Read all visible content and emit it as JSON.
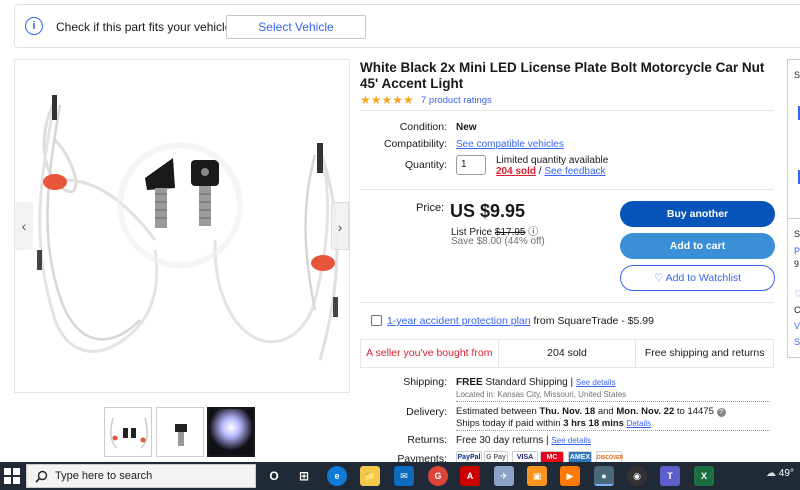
{
  "fits": {
    "text": "Check if this part fits your vehicle",
    "button": "Select Vehicle"
  },
  "listing": {
    "title": "White Black 2x Mini LED License Plate Bolt Motorcycle Car Nut 45' Accent Light",
    "stars": "★★★★★",
    "ratings_link": "7 product ratings"
  },
  "details": {
    "condition_label": "Condition:",
    "condition_value": "New",
    "compat_label": "Compatibility:",
    "compat_link": "See compatible vehicles",
    "qty_label": "Quantity:",
    "qty_value": "1",
    "qty_note": "Limited quantity available",
    "sold": "204 sold",
    "sep": " / ",
    "feedback": "See feedback"
  },
  "price": {
    "label": "Price:",
    "value": "US $9.95",
    "list_prefix": "List Price ",
    "list_value": "$17.95",
    "info_icon": "ⓘ",
    "save": "Save $8.00 (44% off)"
  },
  "buttons": {
    "buy": "Buy another",
    "cart": "Add to cart",
    "watch": "♡ Add to Watchlist"
  },
  "protection": {
    "link": "1-year accident protection plan",
    "rest": " from SquareTrade - $5.99"
  },
  "badges": [
    "A seller you've bought from",
    "204 sold",
    "Free shipping and returns"
  ],
  "shipping": {
    "label": "Shipping:",
    "free": "FREE",
    "method": " Standard Shipping | ",
    "details_link": "See details",
    "location": "Located in: Kansas City, Missouri, United States"
  },
  "delivery": {
    "label": "Delivery:",
    "prefix": "Estimated between ",
    "date1": "Thu. Nov. 18",
    "and": " and ",
    "date2": "Mon. Nov. 22",
    "to": " to 14475 ",
    "help_icon": "?",
    "ships_prefix": "Ships today if paid within ",
    "ships_time": "3 hrs 18 mins",
    "ships_details": "Details"
  },
  "returns": {
    "label": "Returns:",
    "text": "Free 30 day returns | ",
    "link": "See details"
  },
  "payments": {
    "label": "Payments:",
    "logos": [
      "PayPal",
      "G Pay",
      "VISA",
      "MC",
      "AMEX",
      "DISCOVER"
    ]
  },
  "right_panel": {
    "letters": [
      "S",
      "S",
      "P",
      "9",
      "C",
      "V",
      "S"
    ]
  },
  "taskbar": {
    "search_placeholder": "Type here to search",
    "temp": "49°",
    "icons": [
      "O",
      "⊞",
      "e",
      "📁",
      "✉",
      "G",
      "A",
      "✈",
      "▣",
      "▶",
      "●",
      "◉",
      "T",
      "X"
    ]
  },
  "colors": {
    "brand_blue": "#3665f3",
    "buy_button": "#0654ba",
    "cart_button": "#3b8fd6",
    "sold_red": "#dd1e31",
    "star_gold": "#f5a623",
    "taskbar": "#1f2a36"
  }
}
